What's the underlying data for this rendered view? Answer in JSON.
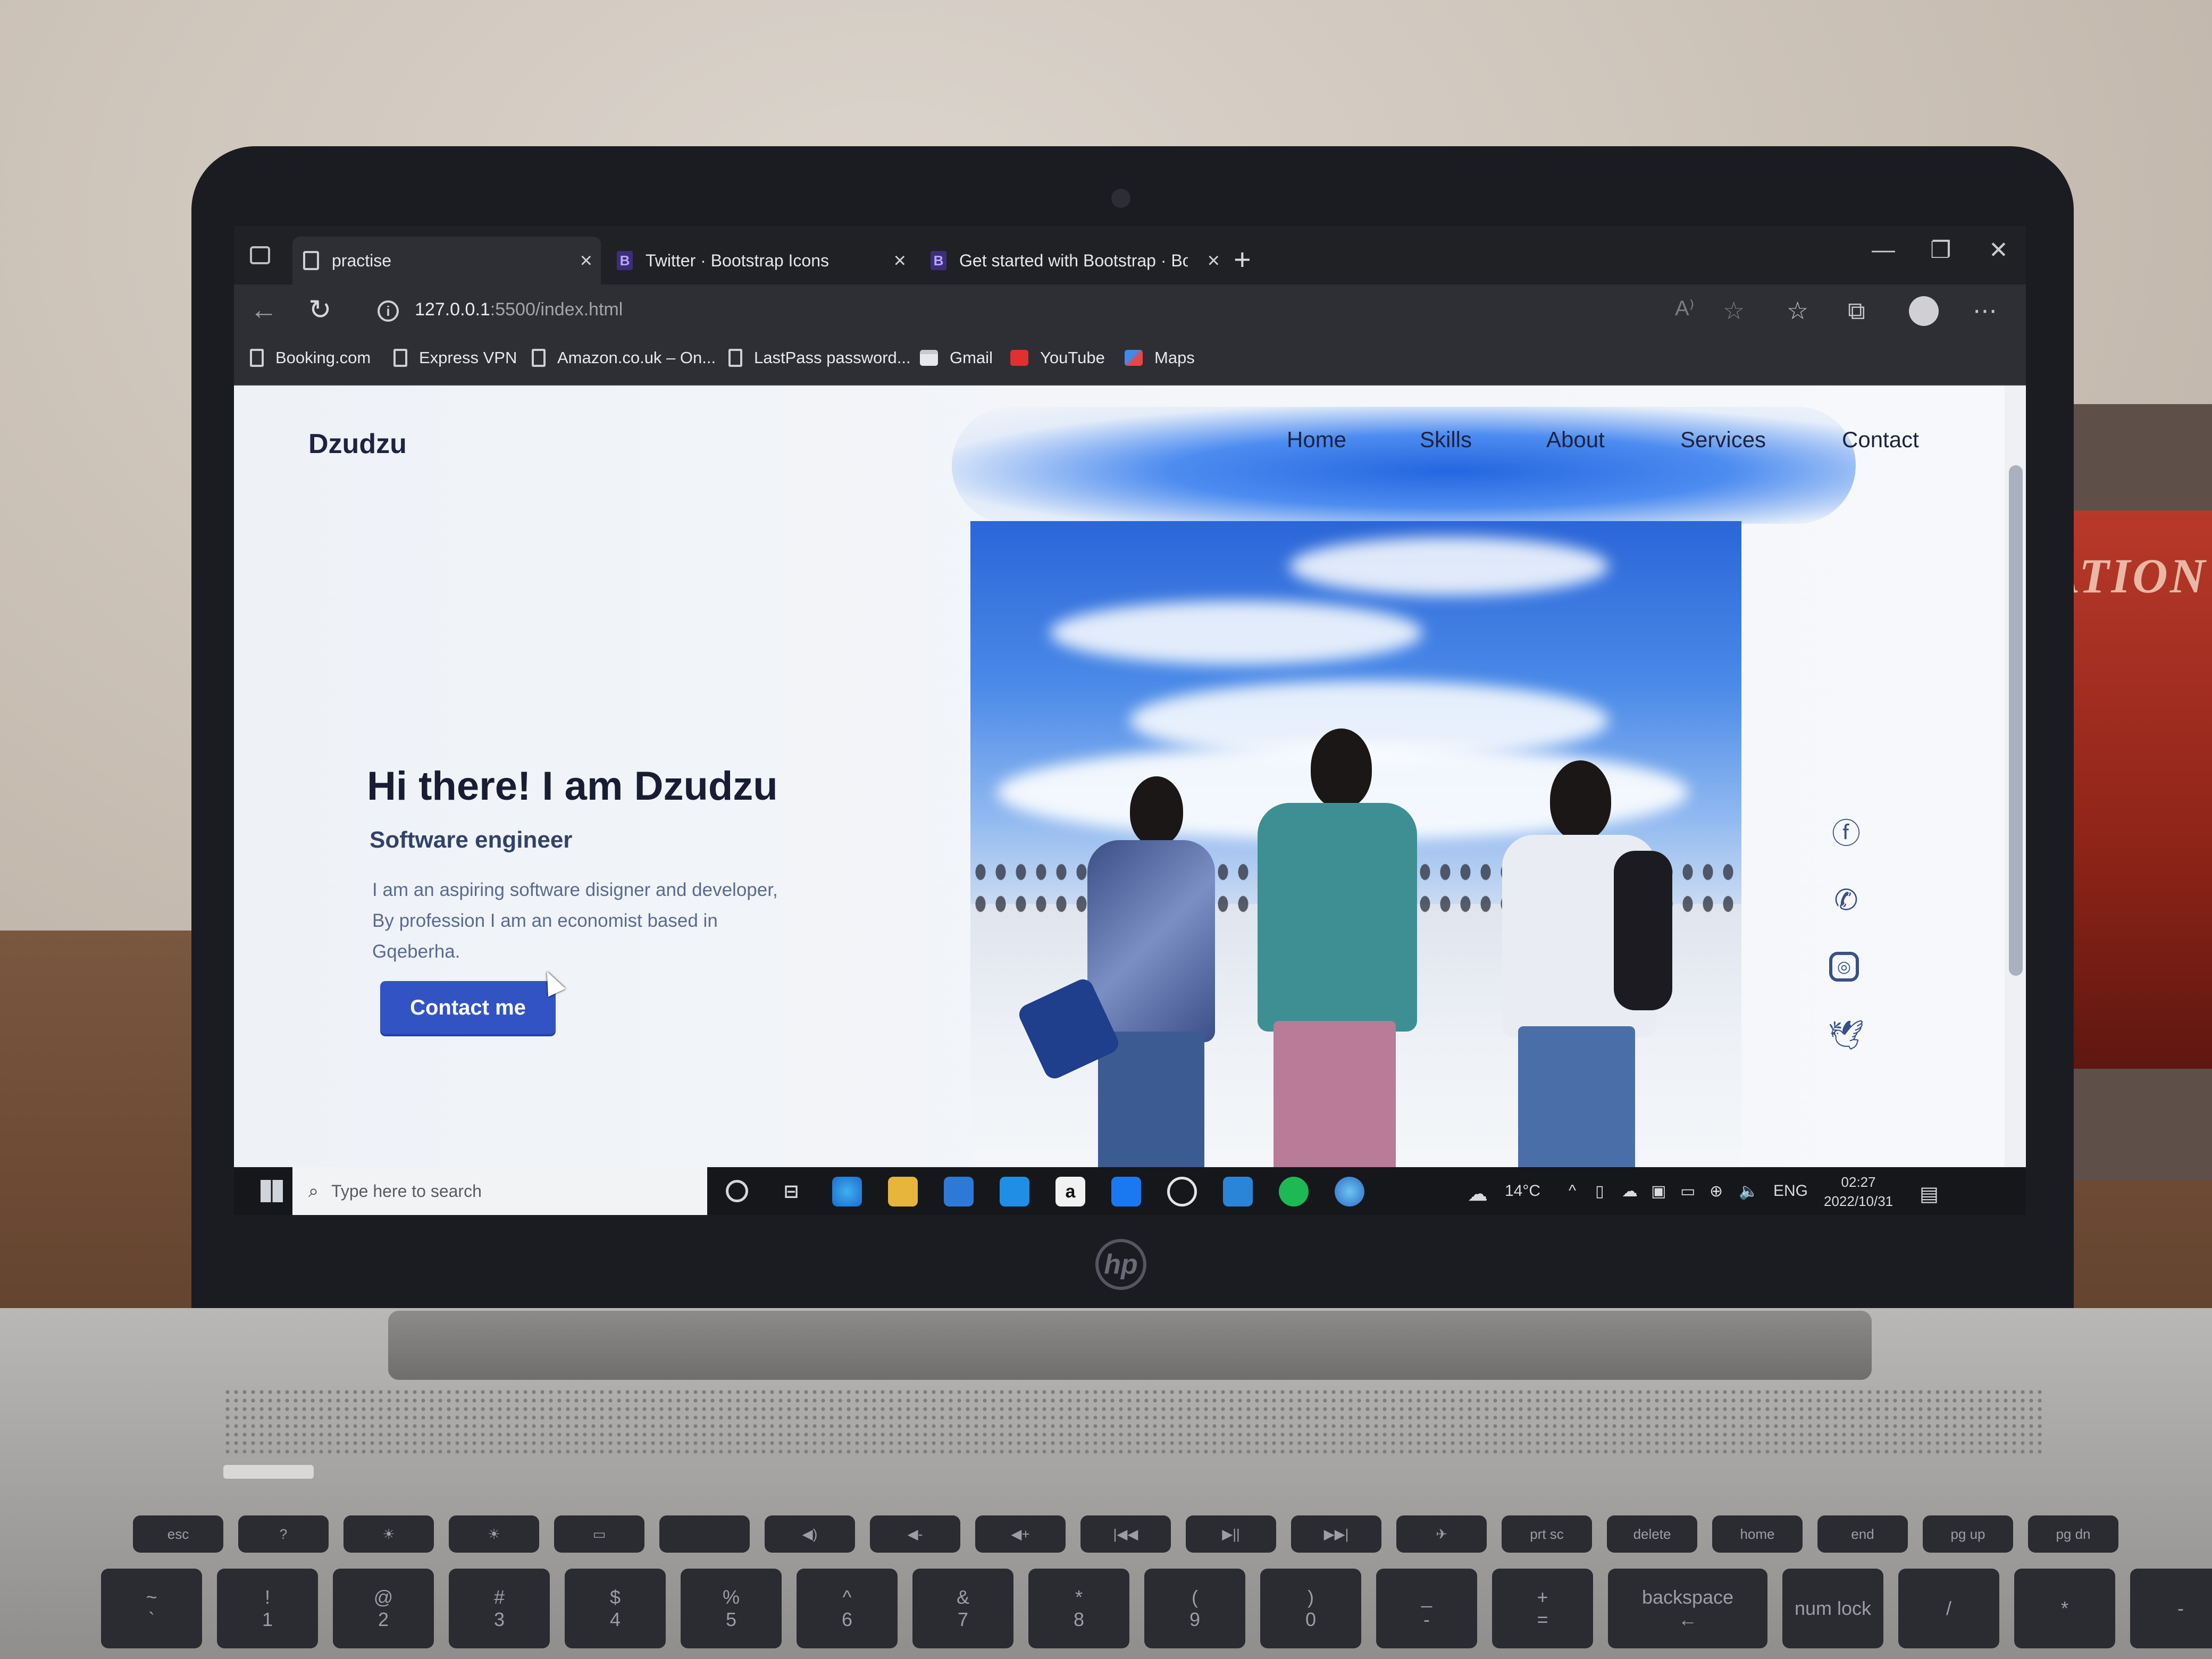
{
  "browser": {
    "tabs": [
      {
        "label": "practise",
        "icon": "page-icon",
        "active": true
      },
      {
        "label": "Twitter · Bootstrap Icons",
        "icon": "bootstrap-icon",
        "active": false
      },
      {
        "label": "Get started with Bootstrap · Boo",
        "icon": "bootstrap-icon",
        "active": false
      }
    ],
    "close_glyph": "×",
    "new_tab_glyph": "+",
    "url_host": "127.0.0.1",
    "url_path": ":5500/index.html",
    "info_glyph": "i",
    "window_controls": [
      "—",
      "❐",
      "✕"
    ],
    "toolbar_icons": [
      "read-aloud-icon",
      "favorite-add-icon",
      "favorites-icon",
      "collections-icon",
      "profile-icon",
      "more-icon"
    ],
    "bookmarks": [
      {
        "label": "Booking.com",
        "icon": "page-icon"
      },
      {
        "label": "Express VPN",
        "icon": "page-icon"
      },
      {
        "label": "Amazon.co.uk – On...",
        "icon": "page-icon"
      },
      {
        "label": "LastPass password...",
        "icon": "page-icon"
      },
      {
        "label": "Gmail",
        "icon": "gmail-icon"
      },
      {
        "label": "YouTube",
        "icon": "youtube-icon"
      },
      {
        "label": "Maps",
        "icon": "maps-icon"
      }
    ]
  },
  "site": {
    "brand": "Dzudzu",
    "nav": [
      "Home",
      "Skills",
      "About",
      "Services",
      "Contact"
    ],
    "hero_title": "Hi there! I am Dzudzu",
    "hero_subtitle": "Software engineer",
    "hero_description": "I am an aspiring software disigner and developer, By profession I am an economist based in Gqeberha.",
    "cta_label": "Contact me",
    "social_icons": [
      "facebook-icon",
      "whatsapp-icon",
      "instagram-icon",
      "twitter-icon"
    ]
  },
  "taskbar": {
    "search_placeholder": "Type here to search",
    "apps": [
      "cortana-icon",
      "task-view-icon",
      "edge-icon",
      "file-explorer-icon",
      "store-icon",
      "mail-icon",
      "amazon-icon",
      "dropbox-icon",
      "app-icon",
      "vscode-icon",
      "spotify-icon",
      "browser-icon"
    ],
    "weather": "14°C",
    "language": "ENG",
    "time": "02:27",
    "date": "2022/10/31"
  },
  "laptop": {
    "brand": "hp",
    "keys_fn": [
      "esc",
      "?",
      "☀",
      "☀",
      "▭",
      "",
      "◀)",
      "◀-",
      "◀+",
      "|◀◀",
      "▶||",
      "▶▶|",
      "✈",
      "prt sc",
      "delete",
      "home",
      "end",
      "pg up",
      "pg dn"
    ],
    "keys_num": [
      "~",
      "!",
      "@",
      "#",
      "$",
      "%",
      "^",
      "&",
      "*",
      "(",
      ")",
      "_",
      "+",
      "backspace",
      "num lock",
      "/",
      "*",
      "-"
    ],
    "keys_num_lower": [
      "`",
      "1",
      "2",
      "3",
      "4",
      "5",
      "6",
      "7",
      "8",
      "9",
      "0",
      "-",
      "=",
      "←",
      "",
      "",
      "",
      ""
    ],
    "poster_text": "ATION"
  }
}
